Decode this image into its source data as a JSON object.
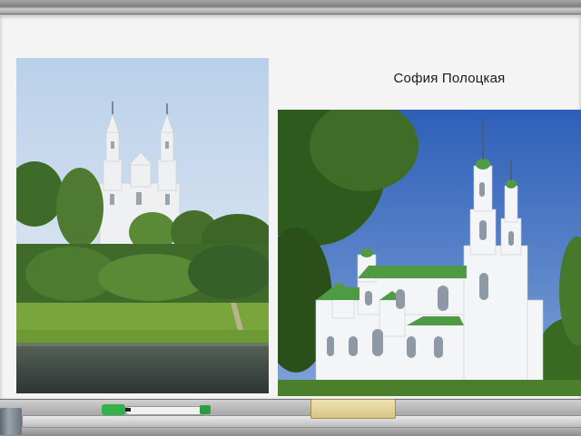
{
  "slide": {
    "title": "София Полоцкая"
  },
  "images": [
    {
      "name": "sofia-cathedral-river-view"
    },
    {
      "name": "sofia-cathedral-close-view"
    }
  ],
  "colors": {
    "board": "#f4f4f4",
    "frame": "#8a8a8a",
    "marker_cap": "#33b24a"
  },
  "icons": [
    "eraser-icon",
    "marker-icon",
    "sponge-icon"
  ]
}
